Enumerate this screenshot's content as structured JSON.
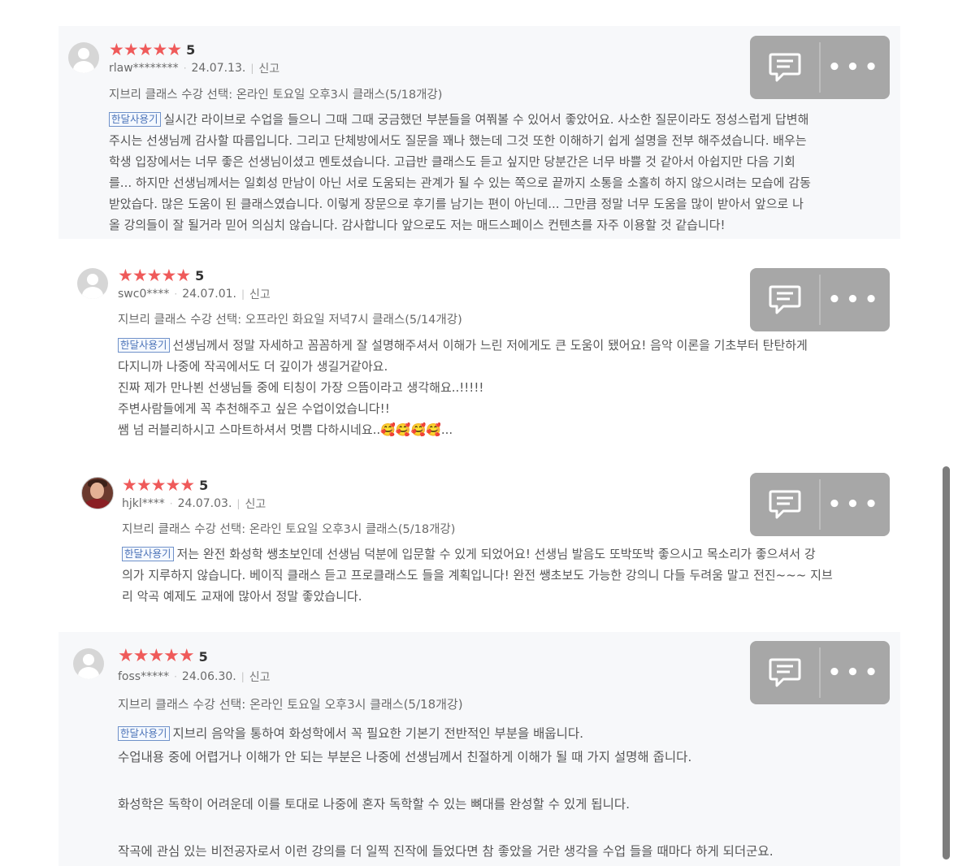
{
  "reviews": [
    {
      "stars": "★★★★★",
      "score": "5",
      "user": "rlaw********",
      "date": "24.07.13.",
      "report": "신고",
      "option": "지브리 클래스 수강 선택: 온라인 토요일 오후3시 클래스(5/18개강)",
      "badge": "한달사용기",
      "lines": [
        "실시간 라이브로 수업을 들으니 그때 그때 궁금했던 부분들을 여쭤볼 수 있어서 좋았어요. 사소한 질문이라도 정성스럽게 답변해",
        "주시는 선생님께 감사할 따름입니다. 그리고 단체방에서도 질문을 꽤나 했는데 그것 또한 이해하기 쉽게 설명을 전부 해주셨습니다. 배우는",
        "학생 입장에서는 너무 좋은 선생님이셨고 멘토셨습니다. 고급반 클래스도 듣고 싶지만 당분간은 너무 바쁠 것 같아서 아쉽지만 다음 기회",
        "를... 하지만 선생님께서는 일회성 만남이 아닌 서로 도움되는 관계가 될 수 있는 쪽으로 끝까지 소통을 소홀히 하지 않으시려는 모습에 감동",
        "받았습다. 많은 도움이 된 클래스였습니다. 이렇게 장문으로 후기를 남기는 편이 아닌데... 그만큼 정말 너무 도움을 많이 받아서 앞으로 나",
        "올 강의들이 잘 될거라 믿어 의심치 않습니다. 감사합니다 앞으로도 저는 매드스페이스 컨텐츠를 자주 이용할 것 같습니다!"
      ]
    },
    {
      "stars": "★★★★★",
      "score": "5",
      "user": "swc0****",
      "date": "24.07.01.",
      "report": "신고",
      "option": "지브리 클래스 수강 선택: 오프라인 화요일 저녁7시 클래스(5/14개강)",
      "badge": "한달사용기",
      "lines": [
        "선생님께서 정말 자세하고 꼼꼼하게 잘 설명해주셔서 이해가 느린 저에게도 큰 도움이 됐어요!  음악 이론을 기초부터 탄탄하게",
        "다지니까 나중에 작곡에서도 더 깊이가 생길거같아요.",
        "진짜 제가 만나뵌 선생님들 중에 티칭이 가장 으뜸이라고 생각해요..!!!!!",
        "주변사람들에게 꼭 추천해주고 싶은 수업이었습니다!!",
        "쌤 넘 러블리하시고 스마트하셔서 멋쁨 다하시네요..🥰🥰🥰🥰..."
      ]
    },
    {
      "stars": "★★★★★",
      "score": "5",
      "user": "hjkl****",
      "date": "24.07.03.",
      "report": "신고",
      "option": "지브리 클래스 수강 선택: 온라인 토요일 오후3시 클래스(5/18개강)",
      "badge": "한달사용기",
      "lines": [
        "저는 완전 화성학 쌩초보인데 선생님 덕분에 입문할 수 있게 되었어요! 선생님 발음도 또박또박 좋으시고 목소리가 좋으셔서 강",
        "의가 지루하지 않습니다. 베이직 클래스 듣고 프로클래스도 들을 계획입니다! 완전 쌩초보도 가능한 강의니 다들 두려움 말고 전진~~~ 지브",
        "리 악곡 예제도 교재에 많아서 정말 좋았습니다."
      ]
    },
    {
      "stars": "★★★★★",
      "score": "5",
      "user": "foss*****",
      "date": "24.06.30.",
      "report": "신고",
      "option": "지브리 클래스 수강 선택: 온라인 토요일 오후3시 클래스(5/18개강)",
      "badge": "한달사용기",
      "lines": [
        "지브리 음악을 통하여 화성학에서 꼭 필요한 기본기 전반적인 부분을 배웁니다.",
        "수업내용 중에 어렵거나 이해가 안 되는 부분은 나중에 선생님께서 친절하게 이해가 될 때 가지 설명해 줍니다.",
        "",
        "화성학은 독학이 어려운데 이를 토대로 나중에 혼자 독학할 수 있는 뼈대를 완성할 수 있게 됩니다.",
        "",
        "작곡에 관심 있는 비전공자로서 이런 강의를 더 일찍 진작에 들었다면 참 좋았을 거란 생각을 수업 들을 때마다 하게 되더군요."
      ]
    }
  ],
  "icons": {
    "comment": "speech-bubble-icon",
    "more": "more-dots-icon"
  },
  "colors": {
    "star": "#ef5a5a",
    "badge": "#4d74b8",
    "action_bg": "#a7a7a7"
  }
}
